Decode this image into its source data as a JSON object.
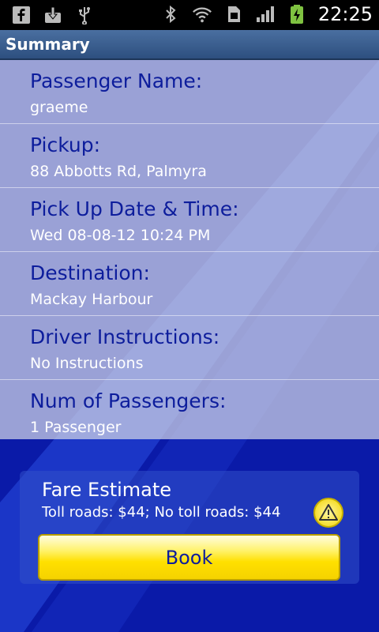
{
  "status_bar": {
    "time": "22:25",
    "left_icons": [
      "facebook-icon",
      "download-icon",
      "usb-icon"
    ],
    "right_icons": [
      "bluetooth-icon",
      "wifi-icon",
      "sim-icon",
      "signal-icon",
      "battery-charging-icon"
    ]
  },
  "title_bar": {
    "title": "Summary"
  },
  "summary": {
    "items": [
      {
        "label": "Passenger Name:",
        "value": "graeme"
      },
      {
        "label": "Pickup:",
        "value": "88 Abbotts Rd, Palmyra"
      },
      {
        "label": "Pick Up Date & Time:",
        "value": "Wed 08-08-12 10:24 PM"
      },
      {
        "label": "Destination:",
        "value": "Mackay Harbour"
      },
      {
        "label": "Driver Instructions:",
        "value": "No Instructions"
      },
      {
        "label": "Num of Passengers:",
        "value": "1 Passenger"
      }
    ]
  },
  "fare": {
    "title": "Fare Estimate",
    "text": "Toll roads: $44; No toll roads: $44",
    "warning_icon": "warning-icon"
  },
  "book_button": {
    "label": "Book"
  },
  "colors": {
    "background": "#0a1aa8",
    "label_text": "#0d1d9c",
    "button_yellow": "#ffe000",
    "title_bar": "#3a5f90"
  }
}
